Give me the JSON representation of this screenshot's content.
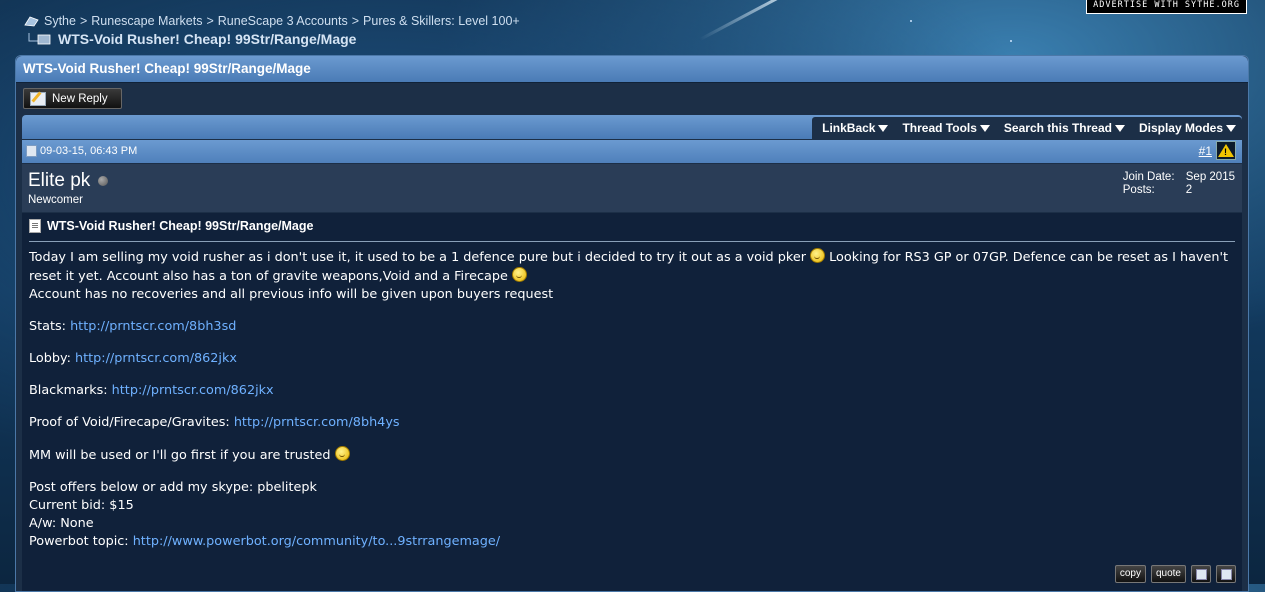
{
  "breadcrumb": {
    "items": [
      "Sythe",
      "Runescape Markets",
      "RuneScape 3 Accounts",
      "Pures & Skillers: Level 100+"
    ],
    "current": "WTS-Void Rusher! Cheap! 99Str/Range/Mage"
  },
  "ad_label": "ADVERTISE WITH SYTHE.ORG",
  "panel": {
    "title": "WTS-Void Rusher! Cheap! 99Str/Range/Mage",
    "new_reply_label": "New Reply"
  },
  "toolbar": {
    "menus": [
      "LinkBack",
      "Thread Tools",
      "Search this Thread",
      "Display Modes"
    ]
  },
  "post": {
    "date": "09-03-15, 06:43 PM",
    "number": "#1",
    "username": "Elite pk",
    "user_title": "Newcomer",
    "join_date_label": "Join Date:",
    "join_date": "Sep 2015",
    "posts_label": "Posts:",
    "posts": "2",
    "title": "WTS-Void Rusher! Cheap! 99Str/Range/Mage",
    "line1a": "Today I am selling my void rusher as i don't use it, it used to be a 1 defence pure but i decided to try it out as a void pker",
    "line1b": " Looking for RS3 GP or 07GP. Defence can be reset as I haven't reset it yet. Account also has a ton of gravite weapons,Void and a Firecape",
    "line2": "Account has no recoveries and all previous info will be given upon buyers request",
    "stats_label": "Stats:",
    "stats_link": "http://prntscr.com/8bh3sd",
    "lobby_label": "Lobby:",
    "lobby_link": "http://prntscr.com/862jkx",
    "blackmarks_label": "Blackmarks:",
    "blackmarks_link": "http://prntscr.com/862jkx",
    "proof_label": "Proof of Void/Firecape/Gravites:",
    "proof_link": "http://prntscr.com/8bh4ys",
    "mm_text": "MM will be used or I'll go first if you are trusted",
    "offers": "Post offers below or add my skype: pbelitepk",
    "bid": "Current bid: $15",
    "aw": "A/w: None",
    "powerbot_label": "Powerbot topic:",
    "powerbot_link": "http://www.powerbot.org/community/to...9strrangemage/",
    "copy_label": "copy",
    "quote_label": "quote"
  }
}
